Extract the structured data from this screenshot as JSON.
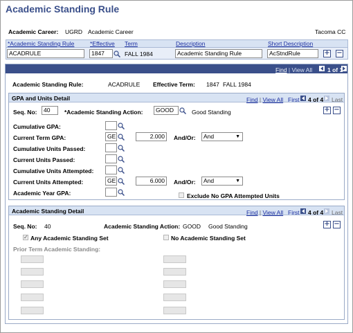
{
  "page": {
    "title": "Academic Standing Rule"
  },
  "context": {
    "career_label": "Academic Career:",
    "career_code": "UGRD",
    "career_desc": "Academic Career",
    "institution": "Tacoma CC"
  },
  "main_grid": {
    "headers": [
      "*Academic Standing Rule",
      "*Effective",
      "Term",
      "Description",
      "Short Description"
    ],
    "row": {
      "rule": "ACADRULE",
      "effective": "1847",
      "term": "FALL 1984",
      "description": "Academic Standing Rule",
      "short_description": "AcStndRule"
    }
  },
  "outer_nav": {
    "find": "Find",
    "view_all": "View All",
    "count": "1 of 1"
  },
  "summary": {
    "rule_label": "Academic Standing Rule:",
    "rule_value": "ACADRULE",
    "term_label": "Effective Term:",
    "term_code": "1847",
    "term_name": "FALL 1984"
  },
  "gpa_section": {
    "title": "GPA and Units Detail",
    "find": "Find",
    "view_all": "View All",
    "first": "First",
    "count": "4 of 4",
    "last": "Last",
    "seq_label": "Seq. No:",
    "seq_value": "40",
    "action_label": "*Academic Standing Action:",
    "action_value": "GOOD",
    "action_desc": "Good Standing",
    "fields": [
      {
        "label": "Cumulative GPA:",
        "op": "",
        "value": "",
        "andor": ""
      },
      {
        "label": "Current Term GPA:",
        "op": "GE",
        "value": "2.000",
        "andor": "And"
      },
      {
        "label": "Cumulative Units Passed:",
        "op": "",
        "value": "",
        "andor": ""
      },
      {
        "label": "Current Units Passed:",
        "op": "",
        "value": "",
        "andor": ""
      },
      {
        "label": "Cumulative Units Attempted:",
        "op": "",
        "value": "",
        "andor": ""
      },
      {
        "label": "Current Units Attempted:",
        "op": "GE",
        "value": "6.000",
        "andor": "And"
      },
      {
        "label": "Academic Year GPA:",
        "op": "",
        "value": "",
        "andor": ""
      }
    ],
    "andor_label": "And/Or:",
    "exclude_label": "Exclude No GPA Attempted Units"
  },
  "standing_section": {
    "title": "Academic Standing Detail",
    "find": "Find",
    "view_all": "View All",
    "first": "First",
    "count": "4 of 4",
    "last": "Last",
    "seq_label": "Seq. No:",
    "seq_value": "40",
    "action_label": "Academic Standing Action:",
    "action_value": "GOOD",
    "action_desc": "Good Standing",
    "any_label": "Any Academic Standing Set",
    "none_label": "No Academic Standing Set",
    "prior_label": "Prior Term Academic Standing:"
  },
  "colors": {
    "brand": "#3a4f8a",
    "link": "#1c2fa0",
    "light_header": "#d8e3f3"
  }
}
